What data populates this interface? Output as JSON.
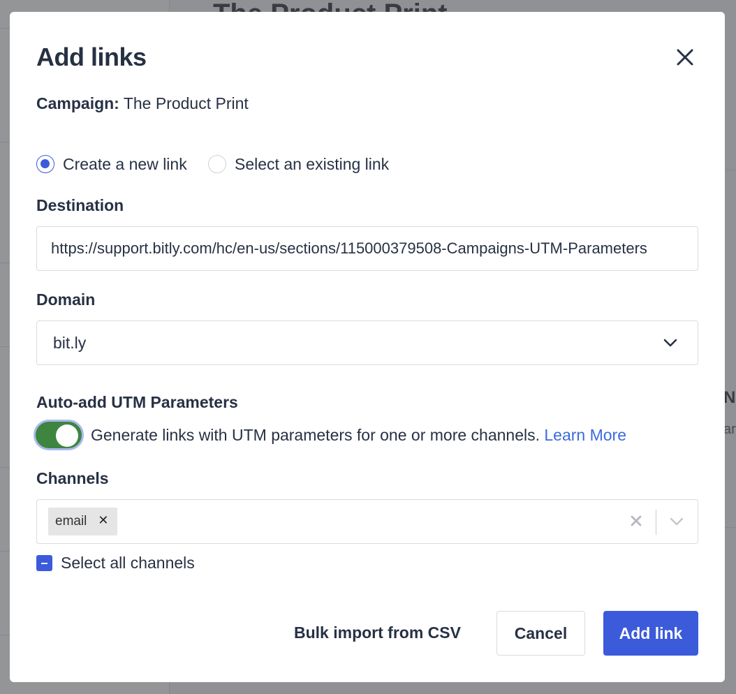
{
  "background": {
    "page_title": "The Product Print",
    "edge_heading": "N",
    "edge_text": "ar"
  },
  "modal": {
    "title": "Add links",
    "close_icon": "close-icon",
    "campaign_label": "Campaign:",
    "campaign_name": "The Product Print",
    "link_mode": {
      "options": [
        {
          "label": "Create a new link",
          "selected": true
        },
        {
          "label": "Select an existing link",
          "selected": false
        }
      ]
    },
    "destination": {
      "label": "Destination",
      "value": "https://support.bitly.com/hc/en-us/sections/115000379508-Campaigns-UTM-Parameters"
    },
    "domain": {
      "label": "Domain",
      "value": "bit.ly",
      "icon": "chevron-down-icon"
    },
    "utm": {
      "label": "Auto-add UTM Parameters",
      "enabled": true,
      "description": "Generate links with UTM parameters for one or more channels.",
      "learn_more": "Learn More"
    },
    "channels": {
      "label": "Channels",
      "selected": [
        "email"
      ],
      "select_all_label": "Select all channels",
      "select_all_state": "indeterminate"
    },
    "footer": {
      "bulk_import": "Bulk import from CSV",
      "cancel": "Cancel",
      "submit": "Add link"
    }
  },
  "colors": {
    "primary": "#3b5bdb",
    "toggle_on": "#3e8540",
    "link": "#3b6bdc",
    "text": "#273144",
    "overlay": "#8f9194"
  }
}
